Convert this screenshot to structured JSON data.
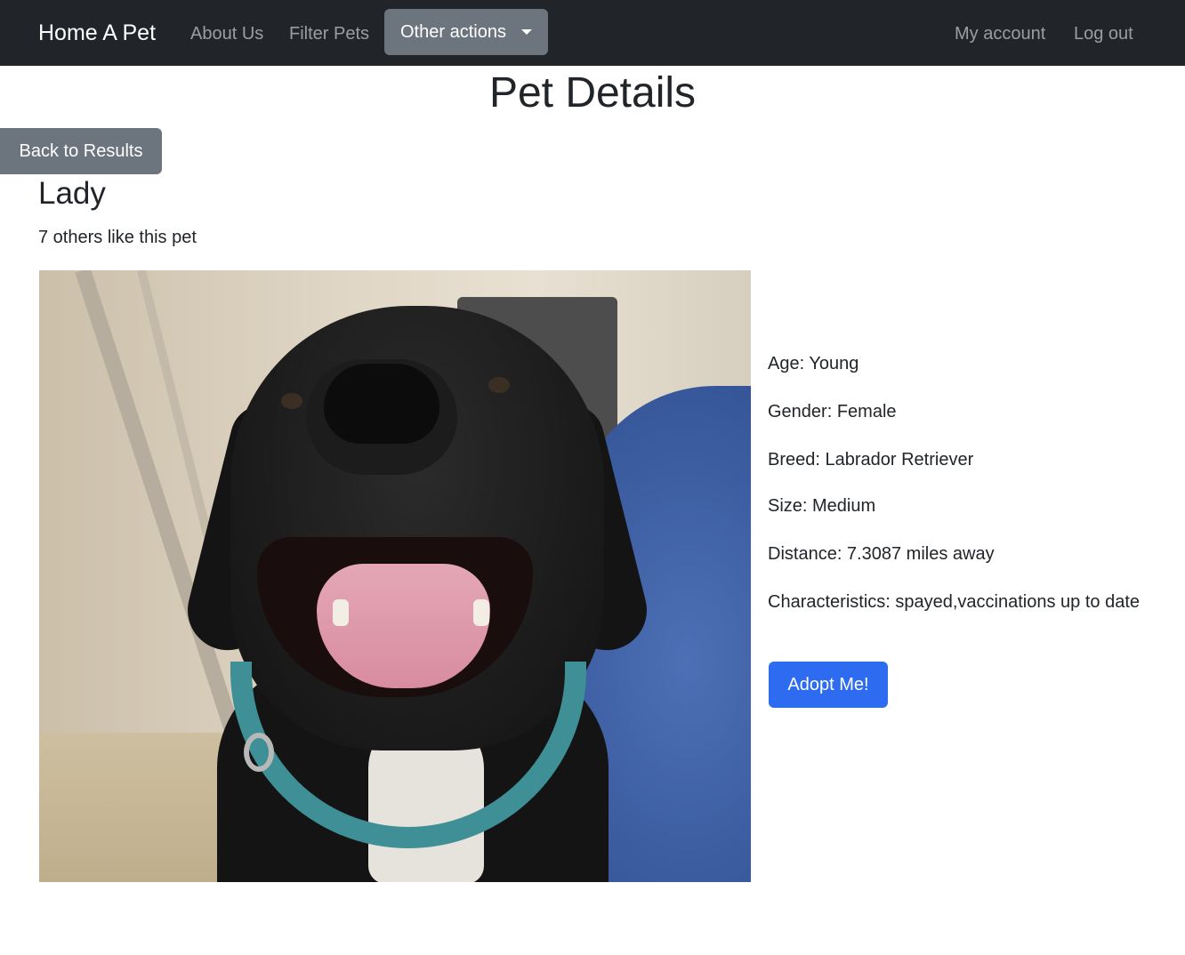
{
  "navbar": {
    "brand": "Home A Pet",
    "links": {
      "about": "About Us",
      "filter": "Filter Pets",
      "account": "My account",
      "logout": "Log out"
    },
    "dropdown_label": "Other actions"
  },
  "page": {
    "title": "Pet Details",
    "back_button": "Back to Results"
  },
  "pet": {
    "name": "Lady",
    "likes_text": "7 others like this pet",
    "details": {
      "age": "Age: Young",
      "gender": "Gender: Female",
      "breed": "Breed: Labrador Retriever",
      "size": "Size: Medium",
      "distance": "Distance: 7.3087 miles away",
      "characteristics": "Characteristics: spayed,vaccinations up to date"
    },
    "adopt_button": "Adopt Me!"
  },
  "colors": {
    "navbar_bg": "#212529",
    "secondary_button": "#6c757d",
    "primary_button": "#2d6cf0"
  }
}
